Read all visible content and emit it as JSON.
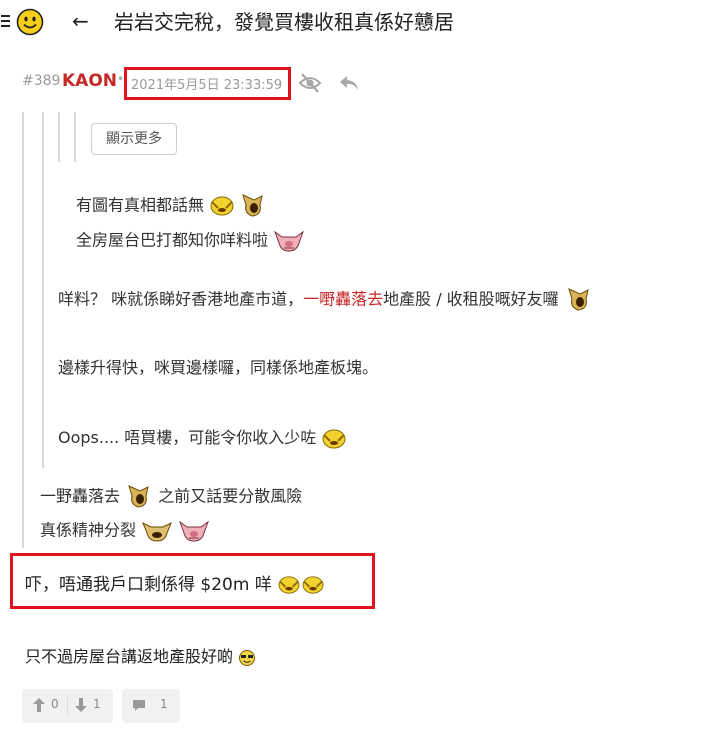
{
  "header": {
    "title": "岩岩交完稅，發覺買樓收租真係好戇居",
    "back_glyph": "←",
    "menu_icon": "hamburger-menu-icon",
    "logo_icon": "smiley-face-icon"
  },
  "post": {
    "number": "#389",
    "author": "KAON",
    "separator": "•",
    "timestamp": "2021年5月5日 23:33:59",
    "accent_color": "#c62828",
    "highlight_color": "#e0141e"
  },
  "quote": {
    "more_label": "顯示更多",
    "nested_line1": "有圖有真相都話無",
    "nested_line2": "全房屋台巴打都知你咩料啦",
    "reply_line1_a": "咩料？ 咪就係睇好香港地產市道，",
    "reply_line1_red": "一嘢轟落去",
    "reply_line1_b": "地產股 / 收租股嘅好友囉",
    "reply_line2": "邊樣升得快，咪買邊樣囉，同樣係地產板塊。",
    "reply_line3": "Oops.... 唔買樓，可能令你收入少咗",
    "outer_line1_a": "一野轟落去",
    "outer_line1_b": "之前又話要分散風險",
    "outer_line2": "真係精神分裂"
  },
  "body": {
    "highlight_line": "吓，唔通我戶口剩係得 $20m 咩",
    "last_line": "只不過房屋台講返地產股好啲"
  },
  "footer": {
    "upvotes": "0",
    "downvotes": "1",
    "comments": "1"
  }
}
